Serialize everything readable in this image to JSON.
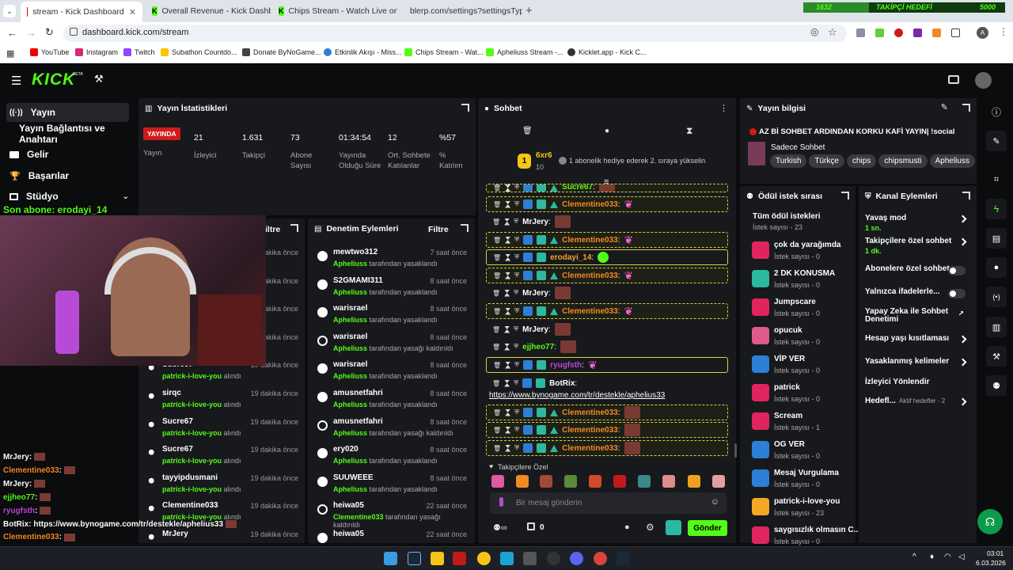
{
  "browser": {
    "tabs": [
      {
        "title": "stream - Kick Dashboard"
      },
      {
        "title": "Overall Revenue - Kick Dashbo"
      },
      {
        "title": "Chips Stream - Watch Live on K"
      },
      {
        "title": "blerp.com/settings?settingsTyp"
      }
    ],
    "url": "dashboard.kick.com/stream",
    "bookmarks": [
      "YouTube",
      "Instagram",
      "Twitch",
      "Subathon Countdo...",
      "Donate ByNoGame...",
      "Etkinlik Akışı - Miss...",
      "Chips Stream - Wat...",
      "Apheliuss Stream -...",
      "Kicklet.app - Kick C..."
    ],
    "goal": {
      "left": "1632",
      "label": "TAKİPÇİ HEDEFİ",
      "right": "5000"
    }
  },
  "kick": {
    "logo": "KICK",
    "beta": "BETA"
  },
  "nav": {
    "items": [
      "Yayın",
      "Yayın Bağlantısı ve Anahtarı",
      "Gelir",
      "Başarılar",
      "Stüdyo"
    ]
  },
  "overlay": {
    "last_sub": "Son abone: erodayi_14",
    "chat": [
      {
        "user": "MrJery",
        "text": ":"
      },
      {
        "user": "Clementine033",
        "text": ":"
      },
      {
        "user": "MrJery",
        "text": ":"
      },
      {
        "user": "ejjheo77",
        "text": ":"
      },
      {
        "user": "ryugfsth",
        "text": ":"
      },
      {
        "user": "BotRix",
        "text": ": https://www.bynogame.com/tr/destekle/aphelius33"
      },
      {
        "user": "Clementine033",
        "text": ":"
      },
      {
        "user": "Clementine033",
        "text": ":"
      }
    ]
  },
  "stats": {
    "title": "Yayın İstatistikleri",
    "live_badge": "YAYINDA",
    "live_label": "Yayın",
    "items": [
      {
        "value": "21",
        "label": "İzleyici"
      },
      {
        "value": "1.631",
        "label": "Takipçi"
      },
      {
        "value": "73",
        "label": "Abone Sayısı"
      },
      {
        "value": "01:34:54",
        "label": "Yayında Olduğu Süre"
      },
      {
        "value": "12",
        "label": "Ort. Sohbete Katılanlar"
      },
      {
        "value": "%57",
        "label": "% Katılım"
      }
    ]
  },
  "activity": {
    "filter": "iltre",
    "rows": [
      {
        "name": "",
        "time": "dakika önce",
        "desc_user": "",
        "desc": ""
      },
      {
        "name": "",
        "time": "dakika önce",
        "desc_user": "",
        "desc": ""
      },
      {
        "name": "",
        "time": "dakika önce",
        "desc_user": "",
        "desc": ""
      },
      {
        "name": "",
        "time": "dakika önce",
        "desc_user": "",
        "desc": ""
      },
      {
        "name": "Sucre67",
        "time": "19 dakika önce",
        "desc_user": "patrick-i-love-you",
        "desc": "alındı"
      },
      {
        "name": "sirqc",
        "time": "19 dakika önce",
        "desc_user": "patrick-i-love-you",
        "desc": "alındı"
      },
      {
        "name": "Sucre67",
        "time": "19 dakika önce",
        "desc_user": "patrick-i-love-you",
        "desc": "alındı"
      },
      {
        "name": "Sucre67",
        "time": "19 dakika önce",
        "desc_user": "patrick-i-love-you",
        "desc": "alındı"
      },
      {
        "name": "tayyipdusmani",
        "time": "19 dakika önce",
        "desc_user": "patrick-i-love-you",
        "desc": "alındı"
      },
      {
        "name": "Clementine033",
        "time": "19 dakika önce",
        "desc_user": "patrick-i-love-you",
        "desc": "alındı"
      },
      {
        "name": "MrJery",
        "time": "19 dakika önce",
        "desc_user": "",
        "desc": ""
      }
    ]
  },
  "moderation": {
    "title": "Denetim Eylemleri",
    "filter": "Filtre",
    "rows": [
      {
        "name": "mewtwo312",
        "time": "7 saat önce",
        "by": "Apheliuss",
        "desc": "tarafından yasaklandı"
      },
      {
        "name": "S2GMAMI311",
        "time": "8 saat önce",
        "by": "Apheliuss",
        "desc": "tarafından yasaklandı"
      },
      {
        "name": "warisrael",
        "time": "8 saat önce",
        "by": "Apheliuss",
        "desc": "tarafından yasaklandı"
      },
      {
        "name": "warisrael",
        "time": "8 saat önce",
        "by": "Apheliuss",
        "desc": "tarafından yasağı kaldırıldı"
      },
      {
        "name": "warisrael",
        "time": "8 saat önce",
        "by": "Apheliuss",
        "desc": "tarafından yasaklandı"
      },
      {
        "name": "amusnetfahri",
        "time": "8 saat önce",
        "by": "Apheliuss",
        "desc": "tarafından yasaklandı"
      },
      {
        "name": "amusnetfahri",
        "time": "8 saat önce",
        "by": "Apheliuss",
        "desc": "tarafından yasağı kaldırıldı"
      },
      {
        "name": "ery020",
        "time": "8 saat önce",
        "by": "Apheliuss",
        "desc": "tarafından yasaklandı"
      },
      {
        "name": "SUUWEEE",
        "time": "8 saat önce",
        "by": "Apheliuss",
        "desc": "tarafından yasaklandı"
      },
      {
        "name": "heiwa05",
        "time": "22 saat önce",
        "by": "Clementine033",
        "desc": "tarafından yasağı kaldırıldı"
      },
      {
        "name": "heiwa05",
        "time": "22 saat önce",
        "by": "",
        "desc": ""
      }
    ]
  },
  "chat": {
    "title": "Sohbet",
    "gift_top": "6xr6",
    "gift_count": "10",
    "gift_msg": "1 abonelik hediye ederek 2. sıraya yükselin",
    "messages": [
      {
        "user": "Sucre67",
        "text": ":"
      },
      {
        "user": "Clementine033",
        "text": ":"
      },
      {
        "user": "MrJery",
        "text": ":"
      },
      {
        "user": "Clementine033",
        "text": ":"
      },
      {
        "user": "erodayi_14",
        "text": ":"
      },
      {
        "user": "Clementine033",
        "text": ":"
      },
      {
        "user": "MrJery",
        "text": ":"
      },
      {
        "user": "Clementine033",
        "text": ":"
      },
      {
        "user": "MrJery",
        "text": ":"
      },
      {
        "user": "ejjheo77",
        "text": ":"
      },
      {
        "user": "ryugfsth",
        "text": ":"
      },
      {
        "user": "BotRix",
        "text": ":"
      },
      {
        "user": "Clementine033",
        "text": ":"
      },
      {
        "user": "Clementine033",
        "text": ":"
      },
      {
        "user": "Clementine033",
        "text": ":"
      }
    ],
    "bot_link": "https://www.bynogame.com/tr/destekle/aphelius33",
    "followers_only": "Takipçilere Özel",
    "placeholder": "Bir mesaj gönderin",
    "count": "0",
    "send": "Gönder"
  },
  "info": {
    "title": "Yayın bilgisi",
    "stream_title": "AZ Bİ SOHBET ARDINDAN KORKU KAFİ YAYIN| !social",
    "category": "Sadece Sohbet",
    "tags": [
      "Turkish",
      "Türkçe",
      "chips",
      "chipsmusti",
      "Apheliuss"
    ]
  },
  "rewards": {
    "title": "Ödül istek sırası",
    "all": "Tüm ödül istekleri",
    "all_count": "İstek sayısı - 23",
    "items": [
      {
        "name": "çok da yarağımda",
        "count": "İstek sayısı - 0",
        "color": "#e0245e"
      },
      {
        "name": "2 DK KONUSMA",
        "count": "İstek sayısı - 0",
        "color": "#2db8a0"
      },
      {
        "name": "Jumpscare",
        "count": "İstek sayısı - 0",
        "color": "#e0245e"
      },
      {
        "name": "opucuk",
        "count": "İstek sayısı - 0",
        "color": "#e05a8a"
      },
      {
        "name": "VİP VER",
        "count": "İstek sayısı - 0",
        "color": "#2d7fd6"
      },
      {
        "name": "patrick",
        "count": "İstek sayısı - 0",
        "color": "#e0245e"
      },
      {
        "name": "Scream",
        "count": "İstek sayısı - 1",
        "color": "#e0245e"
      },
      {
        "name": "OG VER",
        "count": "İstek sayısı - 0",
        "color": "#2d7fd6"
      },
      {
        "name": "Mesaj Vurgulama",
        "count": "İstek sayısı - 0",
        "color": "#2d7fd6"
      },
      {
        "name": "patrick-i-love-you",
        "count": "İstek sayısı - 23",
        "color": "#f5a623"
      },
      {
        "name": "saygısızlık olmasın C...",
        "count": "İstek sayısı - 0",
        "color": "#e0245e"
      }
    ]
  },
  "channel": {
    "title": "Kanal Eylemleri",
    "items": [
      {
        "label": "Yavaş mod",
        "sub": "1 sn.",
        "kind": "arrow"
      },
      {
        "label": "Takipçilere özel sohbet",
        "sub": "1 dk.",
        "kind": "arrow"
      },
      {
        "label": "Abonelere özel sohbet",
        "sub": "",
        "kind": "toggle"
      },
      {
        "label": "Yalnızca ifadelerle...",
        "sub": "",
        "kind": "toggle"
      },
      {
        "label": "Yapay Zeka ile Sohbet Denetimi",
        "sub": "",
        "kind": "ext"
      },
      {
        "label": "Hesap yaşı kısıtlaması",
        "sub": "",
        "kind": "arrow"
      },
      {
        "label": "Yasaklanmış kelimeler",
        "sub": "",
        "kind": "arrow"
      },
      {
        "label": "İzleyici Yönlendir",
        "sub": "",
        "kind": "none"
      },
      {
        "label": "Hedefl...",
        "sub": "Aktif hedefler - 2",
        "kind": "arrow"
      }
    ]
  },
  "taskbar": {
    "time": "03:01",
    "date": "6.03.2026"
  }
}
